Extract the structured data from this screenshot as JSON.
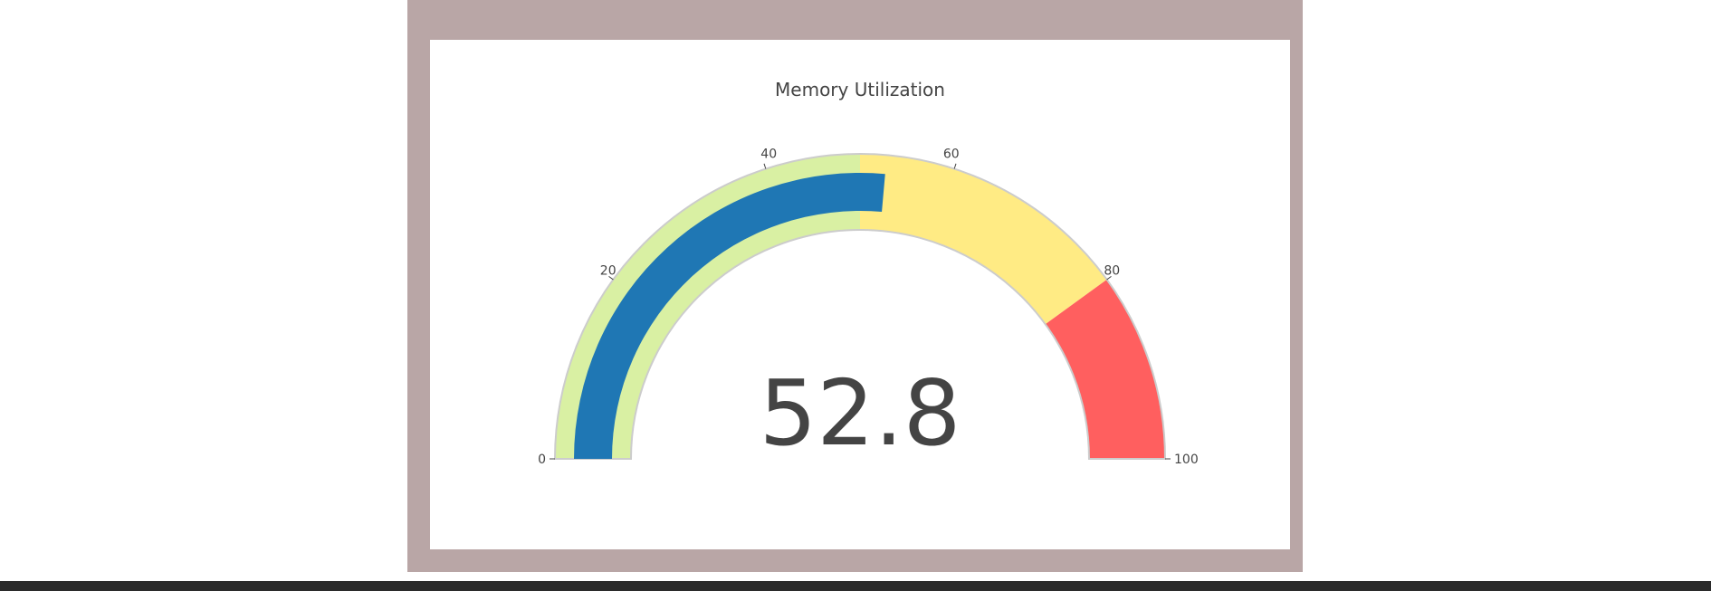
{
  "chart_data": {
    "type": "gauge",
    "title": "Memory Utilization",
    "value": 52.8,
    "value_label": "52.8",
    "range": [
      0,
      100
    ],
    "ticks": [
      {
        "value": 0,
        "label": "0"
      },
      {
        "value": 20,
        "label": "20"
      },
      {
        "value": 40,
        "label": "40"
      },
      {
        "value": 60,
        "label": "60"
      },
      {
        "value": 80,
        "label": "80"
      },
      {
        "value": 100,
        "label": "100"
      }
    ],
    "steps": [
      {
        "range": [
          0,
          50
        ],
        "color": "#d9f0a3"
      },
      {
        "range": [
          50,
          80
        ],
        "color": "#ffeb84"
      },
      {
        "range": [
          80,
          100
        ],
        "color": "#ff5f5f"
      }
    ],
    "bar_color": "#1f77b4",
    "frame_color": "#b9a6a6"
  }
}
